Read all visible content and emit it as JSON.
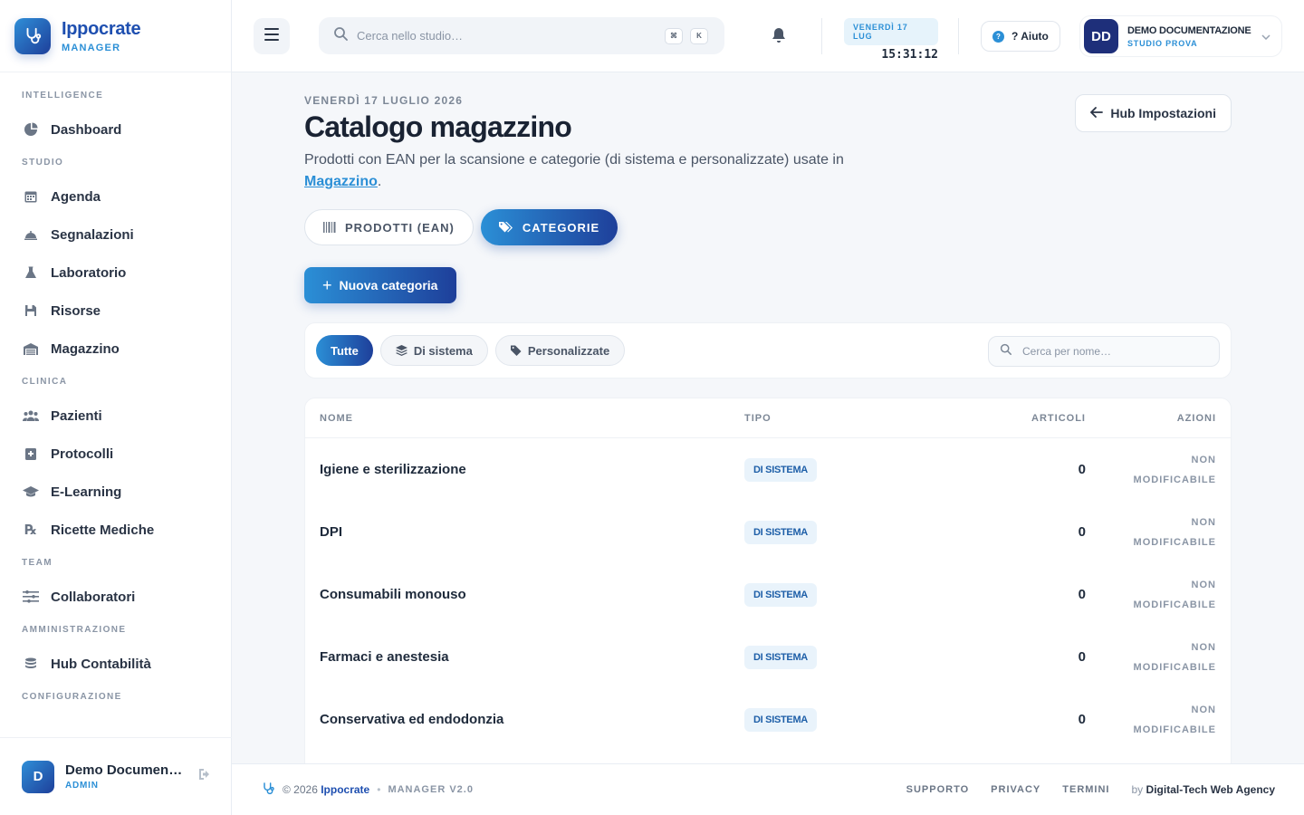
{
  "brand": {
    "name": "Ippocrate",
    "sub": "MANAGER"
  },
  "sidebar": {
    "sections": [
      {
        "label": "INTELLIGENCE",
        "items": [
          {
            "label": "Dashboard",
            "icon": "pie-chart-icon"
          }
        ]
      },
      {
        "label": "STUDIO",
        "items": [
          {
            "label": "Agenda",
            "icon": "calendar-icon"
          },
          {
            "label": "Segnalazioni",
            "icon": "bell-cloche-icon"
          },
          {
            "label": "Laboratorio",
            "icon": "flask-icon"
          },
          {
            "label": "Risorse",
            "icon": "floppy-icon"
          },
          {
            "label": "Magazzino",
            "icon": "warehouse-icon"
          }
        ]
      },
      {
        "label": "CLINICA",
        "items": [
          {
            "label": "Pazienti",
            "icon": "users-icon"
          },
          {
            "label": "Protocolli",
            "icon": "clipboard-plus-icon"
          },
          {
            "label": "E-Learning",
            "icon": "graduation-cap-icon"
          },
          {
            "label": "Ricette Mediche",
            "icon": "prescription-icon"
          }
        ]
      },
      {
        "label": "TEAM",
        "items": [
          {
            "label": "Collaboratori",
            "icon": "sliders-icon"
          }
        ]
      },
      {
        "label": "AMMINISTRAZIONE",
        "items": [
          {
            "label": "Hub Contabilità",
            "icon": "coins-icon"
          }
        ]
      },
      {
        "label": "CONFIGURAZIONE",
        "items": []
      }
    ],
    "user": {
      "initial": "D",
      "name": "Demo Documentazione",
      "role": "ADMIN"
    }
  },
  "topbar": {
    "search_placeholder": "Cerca nello studio…",
    "kbd": [
      "⌘",
      "K"
    ],
    "date_pill": "VENERDÌ 17 LUG",
    "clock": "15:31:12",
    "help_label": "? Aiuto",
    "account": {
      "initials": "DD",
      "name": "DEMO DOCUMENTAZIONE",
      "sub": "STUDIO PROVA"
    }
  },
  "page": {
    "eyebrow": "VENERDÌ 17 LUGLIO 2026",
    "title": "Catalogo magazzino",
    "subtitle_prefix": "Prodotti con EAN per la scansione e categorie (di sistema e personalizzate) usate in",
    "subtitle_link": "Magazzino",
    "subtitle_suffix": ".",
    "hub_button": "Hub Impostazioni",
    "tabs": [
      {
        "label": "PRODOTTI (EAN)",
        "active": false
      },
      {
        "label": "CATEGORIE",
        "active": true
      }
    ],
    "new_button": "Nuova categoria",
    "filters": [
      "Tutte",
      "Di sistema",
      "Personalizzate"
    ],
    "filter_search_placeholder": "Cerca per nome…"
  },
  "table": {
    "columns": [
      "NOME",
      "TIPO",
      "ARTICOLI",
      "AZIONI"
    ],
    "rows": [
      {
        "name": "Igiene e sterilizzazione",
        "type": "DI SISTEMA",
        "articles": "0",
        "action_line1": "NON",
        "action_line2": "MODIFICABILE"
      },
      {
        "name": "DPI",
        "type": "DI SISTEMA",
        "articles": "0",
        "action_line1": "NON",
        "action_line2": "MODIFICABILE"
      },
      {
        "name": "Consumabili monouso",
        "type": "DI SISTEMA",
        "articles": "0",
        "action_line1": "NON",
        "action_line2": "MODIFICABILE"
      },
      {
        "name": "Farmaci e anestesia",
        "type": "DI SISTEMA",
        "articles": "0",
        "action_line1": "NON",
        "action_line2": "MODIFICABILE"
      },
      {
        "name": "Conservativa ed endodonzia",
        "type": "DI SISTEMA",
        "articles": "0",
        "action_line1": "NON",
        "action_line2": "MODIFICABILE"
      }
    ]
  },
  "footer": {
    "year_prefix": "© 2026",
    "brand": "Ippocrate",
    "version": "MANAGER V2.0",
    "links": [
      "SUPPORTO",
      "PRIVACY",
      "TERMINI"
    ],
    "by_prefix": "by",
    "by_name": "Digital-Tech Web Agency"
  },
  "colors": {
    "accent": "#2b8fd6",
    "brand_dark": "#1e3f9a",
    "text": "#1e2a3b"
  }
}
